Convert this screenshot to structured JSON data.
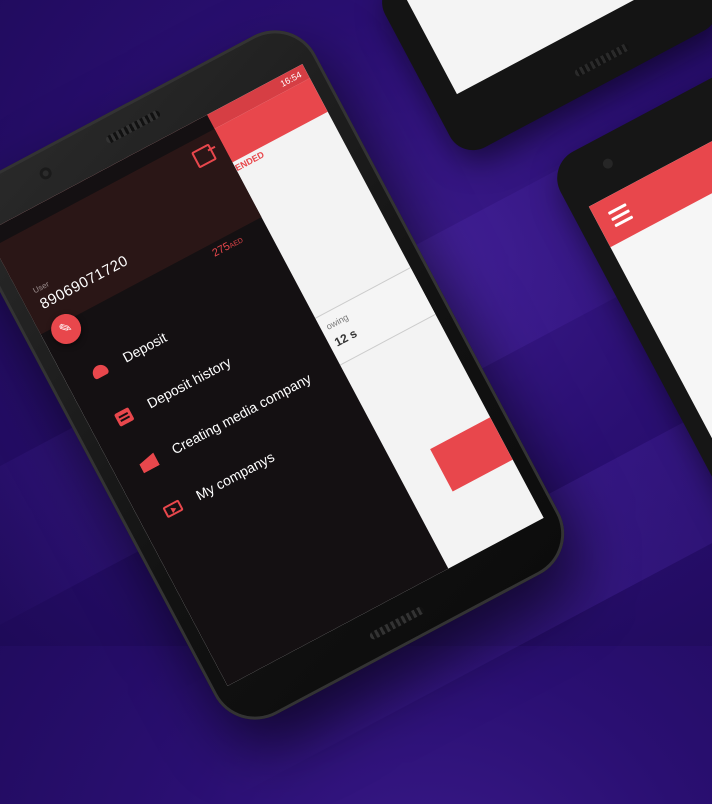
{
  "status_bar": {
    "time": "16:54"
  },
  "background_app": {
    "tab_label": "ENDED",
    "row_label": "owing",
    "row_value": "12 s"
  },
  "drawer": {
    "user_caption": "User",
    "user_phone": "89069071720",
    "balance_amount": "275",
    "balance_currency": "AED",
    "menu_items": [
      {
        "label": "Deposit",
        "icon": "purse-icon"
      },
      {
        "label": "Deposit history",
        "icon": "receipt-icon"
      },
      {
        "label": "Creating media company",
        "icon": "clapperboard-icon"
      },
      {
        "label": "My companys",
        "icon": "video-icon"
      }
    ]
  },
  "colors": {
    "accent": "#e8474c",
    "drawer_bg": "#141012",
    "background": "#2a0f72"
  }
}
